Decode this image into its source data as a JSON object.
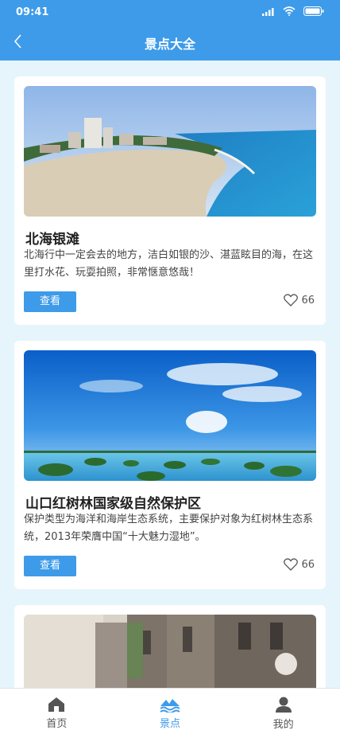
{
  "status": {
    "time": "09:41"
  },
  "header": {
    "title": "景点大全"
  },
  "spots": [
    {
      "name": "北海银滩",
      "desc": "北海行中一定会去的地方，洁白如银的沙、湛蓝眩目的海，在这里打水花、玩耍拍照，非常惬意悠哉！",
      "button": "查看",
      "likes": "66"
    },
    {
      "name": "山口红树林国家级自然保护区",
      "desc": "保护类型为海洋和海岸生态系统，主要保护对象为红树林生态系统，2013年荣膺中国“十大魅力湿地”。",
      "button": "查看",
      "likes": "66"
    },
    {
      "name": "",
      "desc": "",
      "button": "",
      "likes": ""
    }
  ],
  "tabs": [
    {
      "label": "首页",
      "icon": "home-icon"
    },
    {
      "label": "景点",
      "icon": "scenery-icon"
    },
    {
      "label": "我的",
      "icon": "user-icon"
    }
  ],
  "colors": {
    "primary": "#3d9be9",
    "background": "#e6f5fc"
  }
}
